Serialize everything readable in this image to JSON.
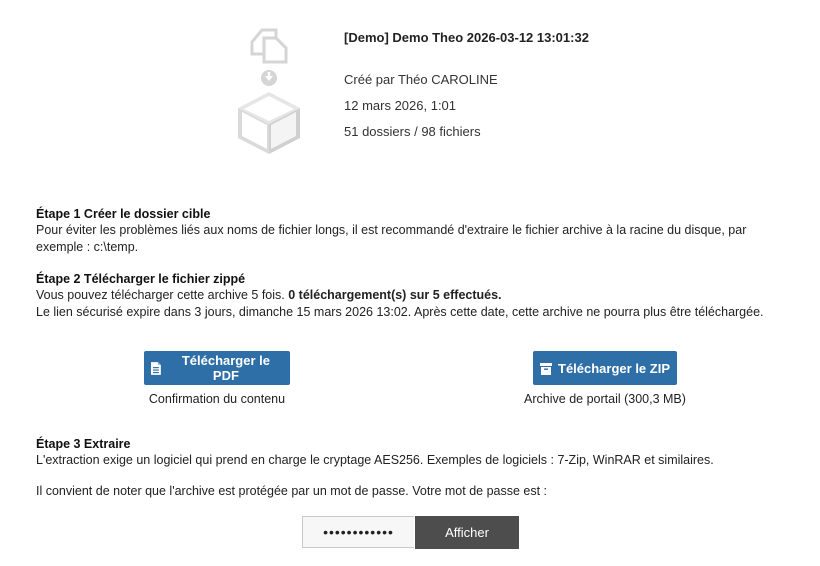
{
  "archive": {
    "title": "[Demo] Demo Theo 2026-03-12 13:01:32",
    "created_by": "Créé par Théo CAROLINE",
    "date": "12 mars 2026, 1:01",
    "counts": "51 dossiers / 98 fichiers"
  },
  "steps": {
    "step1": {
      "title": "Étape 1 Créer le dossier cible",
      "text": "Pour éviter les problèmes liés aux noms de fichier longs, il est recommandé d'extraire le fichier archive à la racine du disque, par exemple : c:\\temp."
    },
    "step2": {
      "title": "Étape 2 Télécharger le fichier zippé",
      "text_a": "Vous pouvez télécharger cette archive 5 fois.",
      "text_b": "0 téléchargement(s) sur 5 effectués.",
      "text_c": "Le lien sécurisé expire dans 3 jours, dimanche 15 mars 2026 13:02. Après cette date, cette archive ne pourra plus être téléchargée."
    },
    "step3": {
      "title": "Étape 3 Extraire",
      "text": "L'extraction exige un logiciel qui prend en charge le cryptage AES256. Exemples de logiciels : 7-Zip, WinRAR et similaires.",
      "password_note": "Il convient de noter que l'archive est protégée par un mot de passe. Votre mot de passe est :"
    }
  },
  "downloads": {
    "pdf_label": "Télécharger le PDF",
    "pdf_caption": "Confirmation du contenu",
    "zip_label": "Télécharger le ZIP",
    "zip_caption": "Archive de portail (300,3 MB)"
  },
  "password": {
    "masked_value": "••••••••••••",
    "show_label": "Afficher"
  },
  "colors": {
    "primary_button": "#2f6fa8",
    "dark_button": "#4d4d4d",
    "icon_gray": "#d9d9d9"
  },
  "icons": [
    "copy-files-icon",
    "download-arrow-icon",
    "box-icon",
    "document-icon",
    "archive-icon"
  ]
}
